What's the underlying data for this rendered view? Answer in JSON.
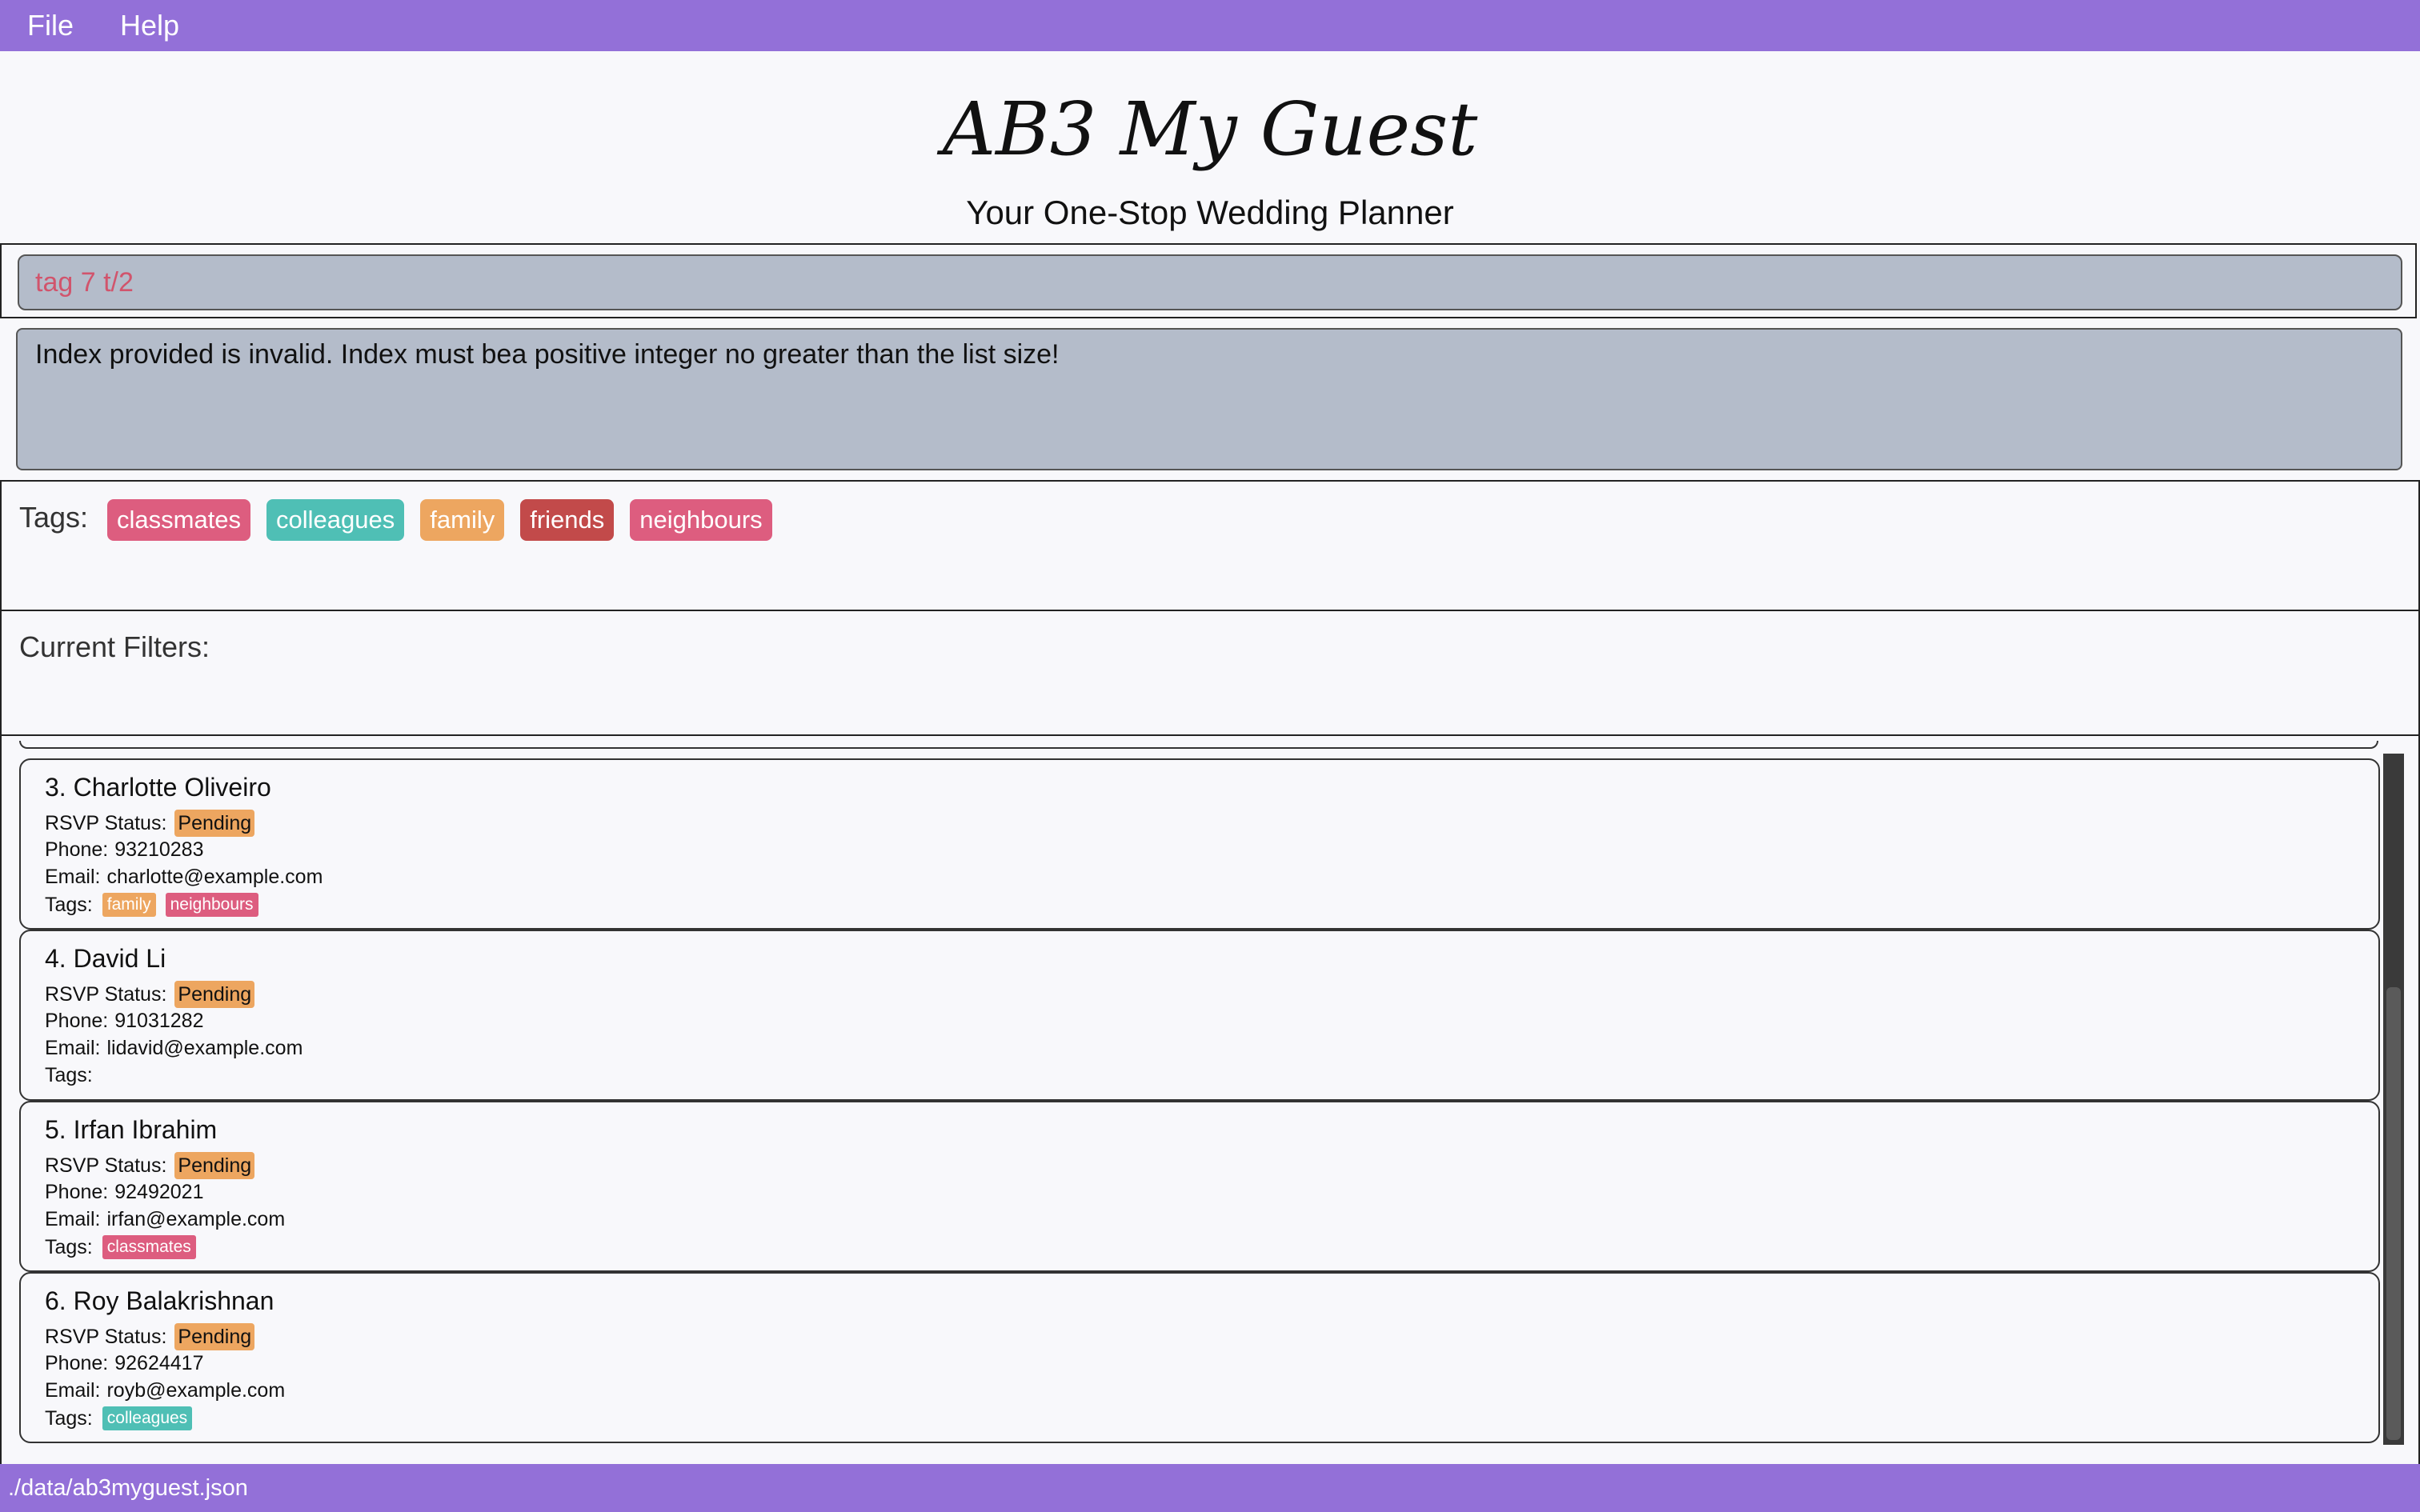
{
  "menu": {
    "file": "File",
    "help": "Help"
  },
  "header": {
    "title": "AB3 My Guest",
    "subtitle": "Your One-Stop Wedding Planner"
  },
  "command": {
    "value": "tag 7 t/2"
  },
  "result": {
    "message": "Index provided is invalid. Index must bea positive integer no greater than the list size!"
  },
  "tags_panel": {
    "label": "Tags:",
    "tags": [
      {
        "name": "classmates",
        "color": "#dd5d7f"
      },
      {
        "name": "colleagues",
        "color": "#4fbfb5"
      },
      {
        "name": "family",
        "color": "#eda660"
      },
      {
        "name": "friends",
        "color": "#c24a4a"
      },
      {
        "name": "neighbours",
        "color": "#dd5d7f"
      }
    ]
  },
  "filters_panel": {
    "label": "Current Filters:"
  },
  "labels": {
    "rsvp": "RSVP Status:",
    "phone": "Phone:",
    "email": "Email:",
    "tags": "Tags:"
  },
  "guests": [
    {
      "name": "3. Charlotte Oliveiro",
      "rsvp": "Pending",
      "phone": "93210283",
      "email": "charlotte@example.com",
      "tags": [
        {
          "name": "family",
          "color": "#eda660"
        },
        {
          "name": "neighbours",
          "color": "#dd5d7f"
        }
      ]
    },
    {
      "name": "4. David Li",
      "rsvp": "Pending",
      "phone": "91031282",
      "email": "lidavid@example.com",
      "tags": []
    },
    {
      "name": "5. Irfan Ibrahim",
      "rsvp": "Pending",
      "phone": "92492021",
      "email": "irfan@example.com",
      "tags": [
        {
          "name": "classmates",
          "color": "#dd5d7f"
        }
      ]
    },
    {
      "name": "6. Roy Balakrishnan",
      "rsvp": "Pending",
      "phone": "92624417",
      "email": "royb@example.com",
      "tags": [
        {
          "name": "colleagues",
          "color": "#4fbfb5"
        }
      ]
    }
  ],
  "status_bar": {
    "path": "./data/ab3myguest.json"
  },
  "colors": {
    "accent": "#9370d8",
    "box_background": "#b4bcca",
    "command_text": "#d1546c",
    "rsvp_pending": "#eda660"
  }
}
